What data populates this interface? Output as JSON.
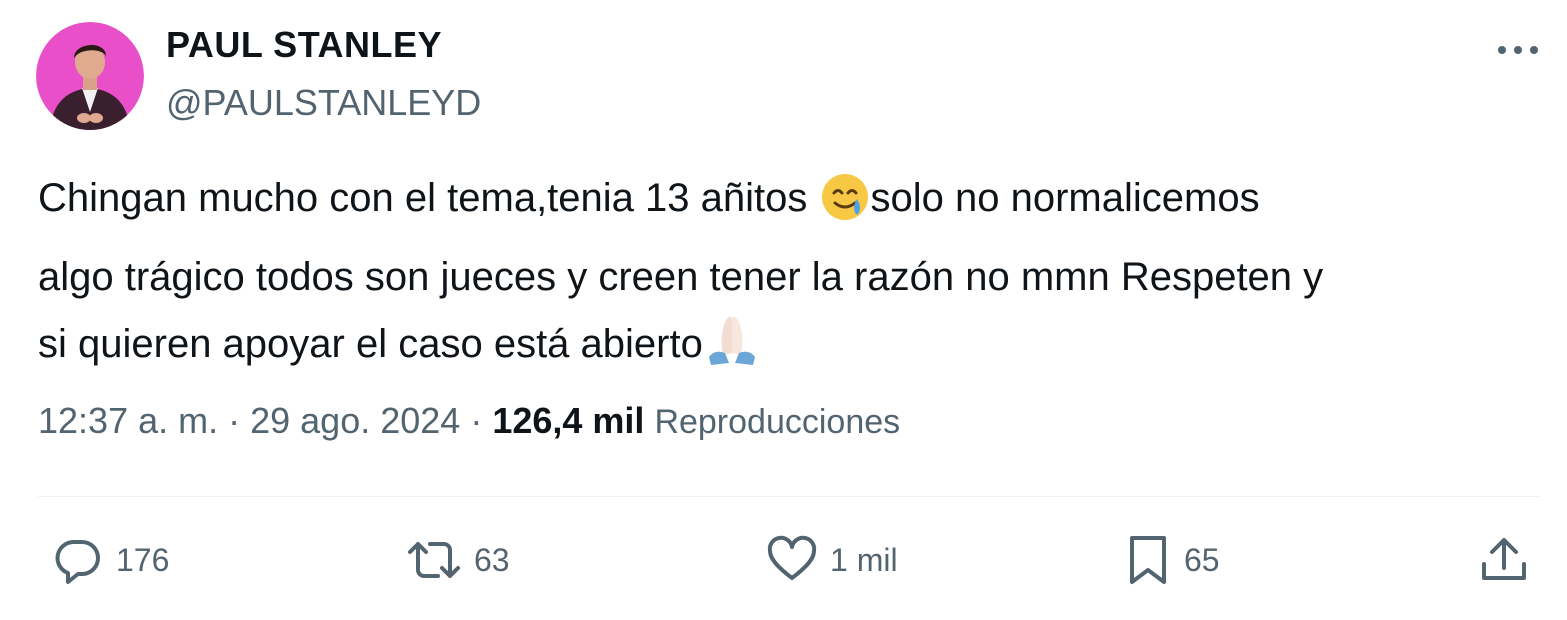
{
  "author": {
    "display_name": "PAUL STANLEY",
    "handle": "@PAULSTANLEYD",
    "avatar_icon": "profile-photo"
  },
  "tweet": {
    "lines": [
      {
        "before": "Chingan mucho con el tema,tenia 13 añitos ",
        "emoji": "smiling-face-with-tear-icon",
        "after": "solo no normalicemos"
      },
      {
        "text": "algo trágico todos son jueces y creen tener la razón no mmn Respeten y"
      },
      {
        "before": "si quieren apoyar el caso está abierto",
        "emoji": "folded-hands-icon",
        "after": ""
      }
    ]
  },
  "meta": {
    "time": "12:37 a. m.",
    "separator": " · ",
    "date": "29 ago. 2024",
    "views_count": "126,4 mil",
    "views_label": "Reproducciones"
  },
  "actions": {
    "replies": {
      "icon": "reply-icon",
      "count": "176"
    },
    "retweets": {
      "icon": "retweet-icon",
      "count": "63"
    },
    "likes": {
      "icon": "heart-icon",
      "count": "1 mil"
    },
    "bookmarks": {
      "icon": "bookmark-icon",
      "count": "65"
    },
    "share": {
      "icon": "share-icon"
    }
  },
  "colors": {
    "text_primary": "#0f1419",
    "text_secondary": "#536471",
    "divider": "#eff3f4",
    "avatar_background": "#e84fc9"
  }
}
